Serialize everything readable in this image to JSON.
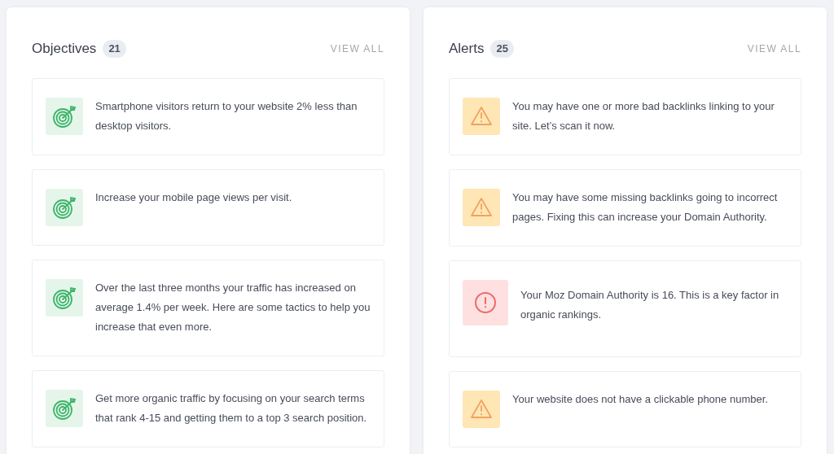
{
  "panels": [
    {
      "title": "Objectives",
      "count": "21",
      "action": "VIEW ALL",
      "items": [
        {
          "kind": "objective",
          "text": "Smartphone visitors return to your website 2% less than desktop visitors."
        },
        {
          "kind": "objective",
          "text": "Increase your mobile page views per visit."
        },
        {
          "kind": "objective",
          "text": "Over the last three months your traffic has increased on average 1.4% per week. Here are some tactics to help you increase that even more."
        },
        {
          "kind": "objective",
          "text": "Get more organic traffic by focusing on your search terms that rank 4-15 and getting them to a top 3 search position."
        }
      ]
    },
    {
      "title": "Alerts",
      "count": "25",
      "action": "VIEW ALL",
      "items": [
        {
          "kind": "warning",
          "text": "You may have one or more bad backlinks linking to your site. Let’s scan it now."
        },
        {
          "kind": "warning",
          "text": "You may have some missing backlinks going to incorrect pages. Fixing this can increase your Domain Authority."
        },
        {
          "kind": "error",
          "text": "Your Moz Domain Authority is 16. This is a key factor in organic rankings."
        },
        {
          "kind": "warning",
          "text": "Your website does not have a clickable phone number."
        }
      ]
    }
  ]
}
